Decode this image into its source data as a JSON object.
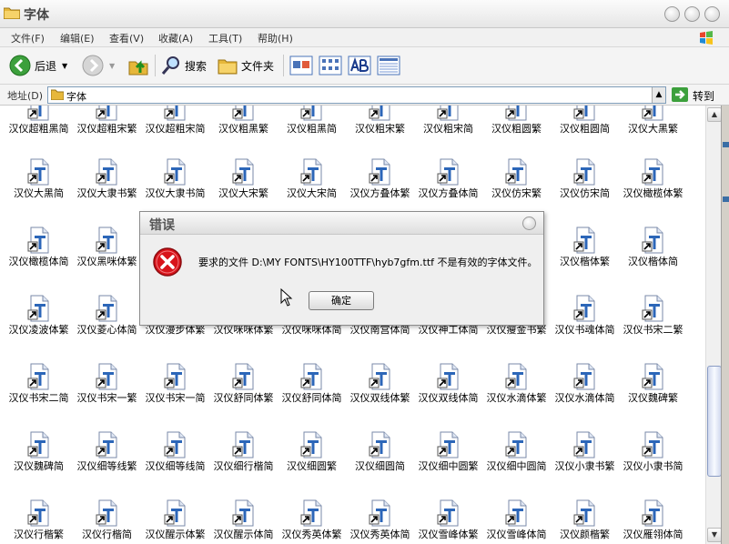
{
  "window": {
    "title": "字体",
    "menu": [
      "文件(F)",
      "编辑(E)",
      "查看(V)",
      "收藏(A)",
      "工具(T)",
      "帮助(H)"
    ]
  },
  "toolbar": {
    "back_label": "后退",
    "search_label": "搜索",
    "folders_label": "文件夹"
  },
  "address": {
    "label": "地址(D)",
    "value": "字体",
    "go_label": "转到"
  },
  "fonts": [
    [
      "汉仪超粗黑简",
      "汉仪超粗宋繁",
      "汉仪超粗宋简",
      "汉仪粗黑繁",
      "汉仪粗黑简",
      "汉仪粗宋繁",
      "汉仪粗宋简",
      "汉仪粗圆繁",
      "汉仪粗圆简",
      "汉仪大黑繁"
    ],
    [
      "汉仪大黑简",
      "汉仪大隶书繁",
      "汉仪大隶书简",
      "汉仪大宋繁",
      "汉仪大宋简",
      "汉仪方叠体繁",
      "汉仪方叠体简",
      "汉仪仿宋繁",
      "汉仪仿宋简",
      "汉仪橄榄体繁"
    ],
    [
      "汉仪橄榄体简",
      "汉仪黑咪体繁",
      "",
      "",
      "",
      "",
      "",
      "",
      "汉仪楷体繁",
      "汉仪楷体简"
    ],
    [
      "汉仪凌波体繁",
      "汉仪菱心体简",
      "汉仪漫步体繁",
      "汉仪咪咪体繁",
      "汉仪咪咪体简",
      "汉仪南宫体简",
      "汉仪神工体简",
      "汉仪瘦金书繁",
      "汉仪书魂体简",
      "汉仪书宋二繁"
    ],
    [
      "汉仪书宋二简",
      "汉仪书宋一繁",
      "汉仪书宋一简",
      "汉仪舒同体繁",
      "汉仪舒同体简",
      "汉仪双线体繁",
      "汉仪双线体简",
      "汉仪水滴体繁",
      "汉仪水滴体简",
      "汉仪魏碑繁"
    ],
    [
      "汉仪魏碑简",
      "汉仪细等线繁",
      "汉仪细等线简",
      "汉仪细行楷简",
      "汉仪细圆繁",
      "汉仪细圆简",
      "汉仪细中圆繁",
      "汉仪细中圆简",
      "汉仪小隶书繁",
      "汉仪小隶书简"
    ],
    [
      "汉仪行楷繁",
      "汉仪行楷简",
      "汉仪醒示体繁",
      "汉仪醒示体简",
      "汉仪秀英体繁",
      "汉仪秀英体简",
      "汉仪雪峰体繁",
      "汉仪雪峰体简",
      "汉仪颜楷繁",
      "汉仪雁翎体简"
    ]
  ],
  "dialog": {
    "title": "错误",
    "message": "要求的文件 D:\\MY FONTS\\HY100TTF\\hyb7gfm.ttf 不是有效的字体文件。",
    "ok_label": "确定"
  },
  "icons": {
    "app": "folder-icon",
    "file": "truetype-font-icon",
    "error": "error-x-icon"
  },
  "colors": {
    "error_red": "#d8141b",
    "font_icon_blue": "#2c66b8",
    "scroll_thumb": "#cfd8ee"
  }
}
